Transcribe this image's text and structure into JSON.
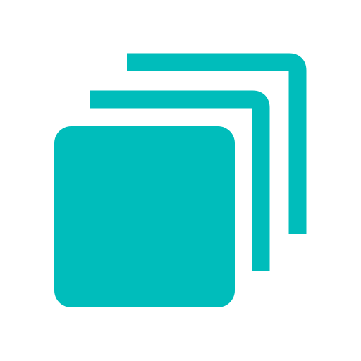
{
  "icon": {
    "name": "stacked-layers-icon",
    "color": "#00BDBB",
    "background": "#FFFFFF",
    "layers": [
      {
        "name": "front-layer-square"
      },
      {
        "name": "middle-layer-outline"
      },
      {
        "name": "back-layer-outline"
      }
    ]
  }
}
